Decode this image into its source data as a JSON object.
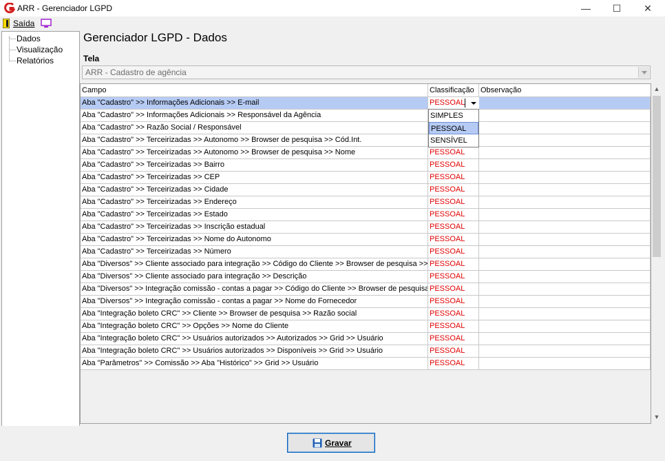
{
  "window": {
    "title": "ARR - Gerenciador LGPD",
    "minimize_glyph": "—",
    "maximize_glyph": "☐",
    "close_glyph": "✕"
  },
  "menu": {
    "exit_label": "Saída",
    "exit_icon": "door-exit-icon",
    "monitor_icon": "monitor-icon"
  },
  "tree": {
    "items": [
      {
        "label": "Dados"
      },
      {
        "label": "Visualização"
      },
      {
        "label": "Relatórios"
      }
    ]
  },
  "main": {
    "title": "Gerenciador LGPD - Dados",
    "tela_label": "Tela",
    "tela_value": "ARR - Cadastro de agência"
  },
  "grid": {
    "columns": [
      "Campo",
      "Classificação",
      "Observação"
    ],
    "editor_value": "PESSOAL",
    "dropdown_options": [
      "SIMPLES",
      "PESSOAL",
      "SENSÍVEL"
    ],
    "rows": [
      {
        "campo": "Aba \"Cadastro\" >> Informações Adicionais >> E-mail",
        "classificacao": "",
        "observacao": ""
      },
      {
        "campo": "Aba \"Cadastro\" >> Informações Adicionais >> Responsável da Agência",
        "classificacao": "",
        "observacao": ""
      },
      {
        "campo": "Aba \"Cadastro\" >> Razão Social / Responsável",
        "classificacao": "",
        "observacao": ""
      },
      {
        "campo": "Aba \"Cadastro\" >> Terceirizadas >> Autonomo >> Browser de pesquisa >> Cód.Int.",
        "classificacao": "",
        "observacao": ""
      },
      {
        "campo": "Aba \"Cadastro\" >> Terceirizadas >> Autonomo >> Browser de pesquisa >> Nome",
        "classificacao": "PESSOAL",
        "observacao": ""
      },
      {
        "campo": "Aba \"Cadastro\" >> Terceirizadas >> Bairro",
        "classificacao": "PESSOAL",
        "observacao": ""
      },
      {
        "campo": "Aba \"Cadastro\" >> Terceirizadas >> CEP",
        "classificacao": "PESSOAL",
        "observacao": ""
      },
      {
        "campo": "Aba \"Cadastro\" >> Terceirizadas >> Cidade",
        "classificacao": "PESSOAL",
        "observacao": ""
      },
      {
        "campo": "Aba \"Cadastro\" >> Terceirizadas >> Endereço",
        "classificacao": "PESSOAL",
        "observacao": ""
      },
      {
        "campo": "Aba \"Cadastro\" >> Terceirizadas >> Estado",
        "classificacao": "PESSOAL",
        "observacao": ""
      },
      {
        "campo": "Aba \"Cadastro\" >> Terceirizadas >> Inscrição estadual",
        "classificacao": "PESSOAL",
        "observacao": ""
      },
      {
        "campo": "Aba \"Cadastro\" >> Terceirizadas >> Nome do  Autonomo",
        "classificacao": "PESSOAL",
        "observacao": ""
      },
      {
        "campo": "Aba \"Cadastro\" >> Terceirizadas >> Número",
        "classificacao": "PESSOAL",
        "observacao": ""
      },
      {
        "campo": "Aba \"Diversos\" >> Cliente associado para integração >> Código do Cliente >> Browser de pesquisa >> ...",
        "classificacao": "PESSOAL",
        "observacao": ""
      },
      {
        "campo": "Aba \"Diversos\" >> Cliente associado para integração >> Descrição",
        "classificacao": "PESSOAL",
        "observacao": ""
      },
      {
        "campo": "Aba \"Diversos\" >> Integração comissão - contas a pagar  >> Código do Cliente >> Browser de pesquisa ...",
        "classificacao": "PESSOAL",
        "observacao": ""
      },
      {
        "campo": "Aba \"Diversos\" >> Integração comissão - contas a pagar >> Nome do Fornecedor",
        "classificacao": "PESSOAL",
        "observacao": ""
      },
      {
        "campo": "Aba \"Integração boleto CRC\" >> Cliente >> Browser de pesquisa >> Razão social",
        "classificacao": "PESSOAL",
        "observacao": ""
      },
      {
        "campo": "Aba \"Integração boleto CRC\" >> Opções >> Nome do Cliente",
        "classificacao": "PESSOAL",
        "observacao": ""
      },
      {
        "campo": "Aba \"Integração boleto CRC\" >> Usuários autorizados >> Autorizados >> Grid >> Usuário",
        "classificacao": "PESSOAL",
        "observacao": ""
      },
      {
        "campo": "Aba \"Integração boleto CRC\" >> Usuários autorizados >> Disponíveis >> Grid >> Usuário",
        "classificacao": "PESSOAL",
        "observacao": ""
      },
      {
        "campo": "Aba \"Parâmetros\" >> Comissão >> Aba \"Histórico\" >> Grid >> Usuário",
        "classificacao": "PESSOAL",
        "observacao": ""
      }
    ]
  },
  "footer": {
    "save_label": "Gravar",
    "save_icon": "floppy-disk-icon"
  },
  "colors": {
    "selected_row": "#b6cbf4",
    "classification_text": "#e00000",
    "button_border": "#0a5fb4"
  }
}
